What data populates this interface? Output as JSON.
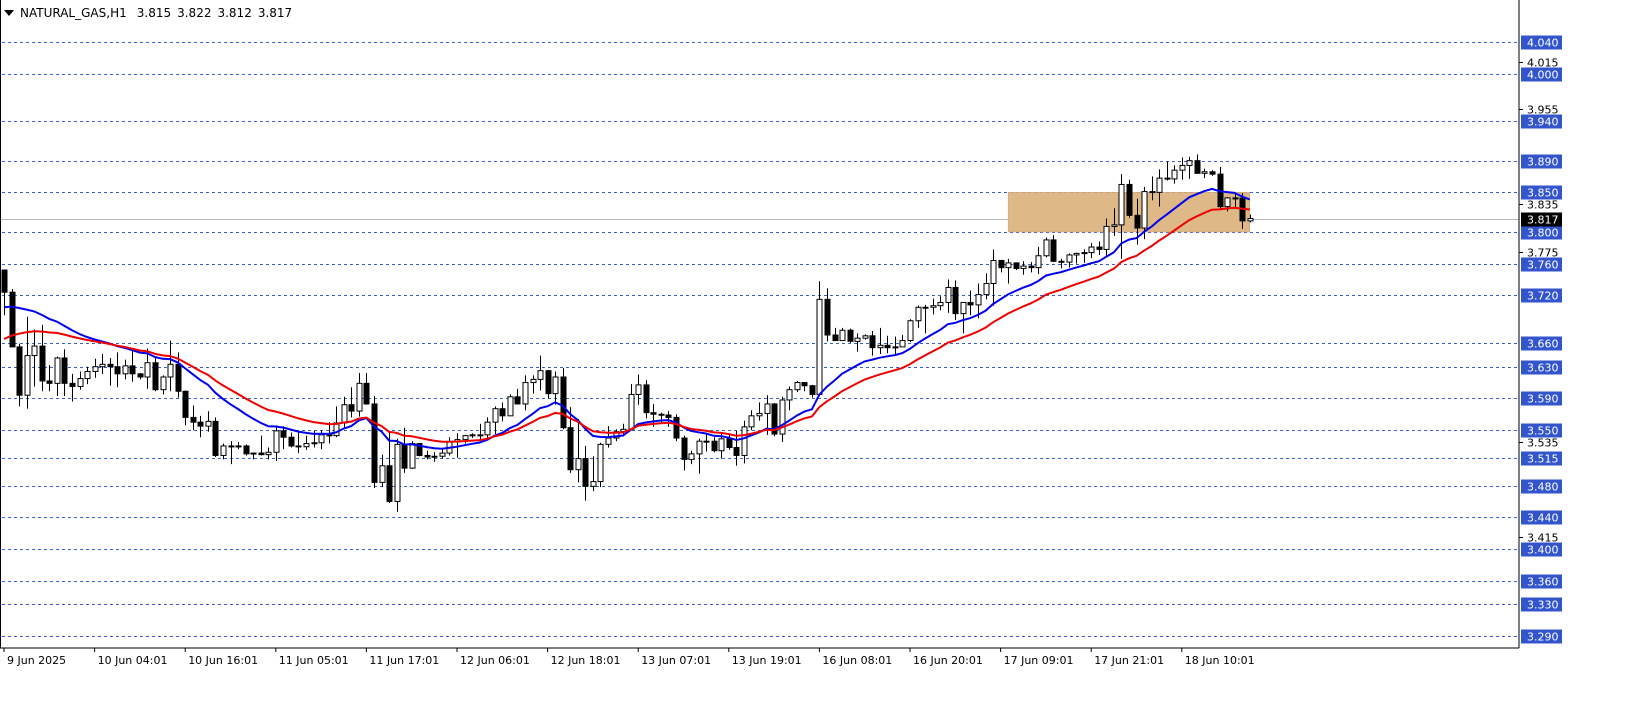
{
  "header": {
    "symbol": "NATURAL_GAS",
    "timeframe": "H1",
    "open": "3.815",
    "high": "3.822",
    "low": "3.812",
    "close": "3.817"
  },
  "chart_data": {
    "type": "candlestick",
    "ylim": [
      3.275,
      4.065
    ],
    "current_price": 3.817,
    "price_axis_ticks": [
      "4.015",
      "3.955",
      "3.835",
      "3.775",
      "3.535",
      "3.415"
    ],
    "price_levels": [
      4.04,
      4.0,
      3.94,
      3.89,
      3.85,
      3.8,
      3.76,
      3.72,
      3.66,
      3.63,
      3.59,
      3.55,
      3.515,
      3.48,
      3.44,
      3.4,
      3.36,
      3.33,
      3.29
    ],
    "price_level_labels": [
      "4.040",
      "4.000",
      "3.940",
      "3.890",
      "3.850",
      "3.800",
      "3.760",
      "3.720",
      "3.660",
      "3.630",
      "3.590",
      "3.550",
      "3.515",
      "3.480",
      "3.440",
      "3.400",
      "3.360",
      "3.330",
      "3.290"
    ],
    "time_labels": [
      "9 Jun 2025",
      "10 Jun 04:01",
      "10 Jun 16:01",
      "11 Jun 05:01",
      "11 Jun 17:01",
      "12 Jun 06:01",
      "12 Jun 18:01",
      "13 Jun 07:01",
      "13 Jun 19:01",
      "16 Jun 08:01",
      "16 Jun 20:01",
      "17 Jun 09:01",
      "17 Jun 21:01",
      "18 Jun 10:01"
    ],
    "time_label_bar_index": [
      0,
      12,
      24,
      36,
      48,
      60,
      72,
      84,
      96,
      108,
      120,
      132,
      144,
      156
    ],
    "zone": {
      "bar_start": 133,
      "bar_end": 165,
      "top": 3.85,
      "bottom": 3.8,
      "color": "#deb887"
    },
    "series": [
      {
        "line": "ma_fast",
        "color": "#0000ee"
      },
      {
        "line": "ma_slow",
        "color": "#ee0000"
      }
    ],
    "anchors_close": [
      [
        0,
        3.74
      ],
      [
        1,
        3.62
      ],
      [
        6,
        3.61
      ],
      [
        12,
        3.63
      ],
      [
        18,
        3.63
      ],
      [
        22,
        3.6
      ],
      [
        25,
        3.54
      ],
      [
        28,
        3.52
      ],
      [
        33,
        3.54
      ],
      [
        38,
        3.55
      ],
      [
        42,
        3.58
      ],
      [
        45,
        3.6
      ],
      [
        47,
        3.54
      ],
      [
        49,
        3.48
      ],
      [
        51,
        3.51
      ],
      [
        55,
        3.52
      ],
      [
        58,
        3.55
      ],
      [
        61,
        3.57
      ],
      [
        64,
        3.6
      ],
      [
        67,
        3.61
      ],
      [
        70,
        3.58
      ],
      [
        72,
        3.49
      ],
      [
        73,
        3.49
      ],
      [
        75,
        3.54
      ],
      [
        77,
        3.57
      ],
      [
        79,
        3.61
      ],
      [
        82,
        3.56
      ],
      [
        85,
        3.53
      ],
      [
        88,
        3.52
      ],
      [
        90,
        3.53
      ],
      [
        93,
        3.52
      ],
      [
        95,
        3.57
      ],
      [
        97,
        3.6
      ],
      [
        99,
        3.6
      ],
      [
        100,
        3.66
      ],
      [
        103,
        3.66
      ],
      [
        106,
        3.66
      ],
      [
        108,
        3.67
      ],
      [
        112,
        3.7
      ],
      [
        114,
        3.7
      ],
      [
        117,
        3.67
      ],
      [
        118,
        3.74
      ],
      [
        120,
        3.75
      ],
      [
        124,
        3.74
      ],
      [
        127,
        3.77
      ],
      [
        132,
        3.79
      ],
      [
        135,
        3.84
      ],
      [
        137,
        3.81
      ],
      [
        139,
        3.82
      ],
      [
        140,
        3.79
      ],
      [
        141,
        3.85
      ],
      [
        145,
        3.87
      ],
      [
        148,
        3.89
      ],
      [
        150,
        3.88
      ],
      [
        153,
        3.88
      ],
      [
        154,
        3.83
      ],
      [
        156,
        3.84
      ],
      [
        157,
        3.84
      ],
      [
        158,
        3.82
      ],
      [
        159,
        3.817
      ]
    ],
    "candles": [
      [
        3.752,
        3.752,
        3.695,
        3.724
      ],
      [
        3.724,
        3.728,
        3.655,
        3.655
      ],
      [
        3.655,
        3.659,
        3.58,
        3.594
      ],
      [
        3.594,
        3.693,
        3.577,
        3.644
      ],
      [
        3.644,
        3.677,
        3.605,
        3.656
      ],
      [
        3.656,
        3.683,
        3.599,
        3.612
      ],
      [
        3.612,
        3.632,
        3.599,
        3.609
      ],
      [
        3.609,
        3.643,
        3.593,
        3.641
      ],
      [
        3.641,
        3.652,
        3.593,
        3.609
      ],
      [
        3.609,
        3.621,
        3.586,
        3.605
      ],
      [
        3.605,
        3.624,
        3.601,
        3.615
      ],
      [
        3.615,
        3.63,
        3.608,
        3.624
      ],
      [
        3.624,
        3.64,
        3.616,
        3.63
      ],
      [
        3.63,
        3.646,
        3.621,
        3.633
      ],
      [
        3.633,
        3.641,
        3.606,
        3.63
      ],
      [
        3.63,
        3.648,
        3.604,
        3.621
      ],
      [
        3.621,
        3.639,
        3.614,
        3.631
      ],
      [
        3.631,
        3.651,
        3.611,
        3.621
      ],
      [
        3.621,
        3.622,
        3.614,
        3.617
      ],
      [
        3.617,
        3.653,
        3.602,
        3.635
      ],
      [
        3.635,
        3.641,
        3.599,
        3.601
      ],
      [
        3.601,
        3.619,
        3.595,
        3.617
      ],
      [
        3.617,
        3.663,
        3.599,
        3.633
      ],
      [
        3.633,
        3.648,
        3.591,
        3.599
      ],
      [
        3.599,
        3.6,
        3.556,
        3.566
      ],
      [
        3.566,
        3.581,
        3.55,
        3.56
      ],
      [
        3.56,
        3.568,
        3.541,
        3.555
      ],
      [
        3.555,
        3.574,
        3.548,
        3.561
      ],
      [
        3.561,
        3.566,
        3.516,
        3.518
      ],
      [
        3.518,
        3.533,
        3.513,
        3.53
      ],
      [
        3.53,
        3.536,
        3.507,
        3.53
      ],
      [
        3.53,
        3.535,
        3.526,
        3.53
      ],
      [
        3.53,
        3.532,
        3.518,
        3.52
      ],
      [
        3.52,
        3.521,
        3.513,
        3.521
      ],
      [
        3.521,
        3.543,
        3.518,
        3.519
      ],
      [
        3.519,
        3.528,
        3.513,
        3.522
      ],
      [
        3.522,
        3.556,
        3.511,
        3.549
      ],
      [
        3.549,
        3.555,
        3.526,
        3.541
      ],
      [
        3.541,
        3.547,
        3.528,
        3.53
      ],
      [
        3.53,
        3.548,
        3.521,
        3.529
      ],
      [
        3.529,
        3.543,
        3.525,
        3.533
      ],
      [
        3.533,
        3.549,
        3.528,
        3.534
      ],
      [
        3.534,
        3.55,
        3.526,
        3.544
      ],
      [
        3.544,
        3.56,
        3.533,
        3.543
      ],
      [
        3.543,
        3.58,
        3.541,
        3.559
      ],
      [
        3.559,
        3.592,
        3.552,
        3.582
      ],
      [
        3.582,
        3.604,
        3.566,
        3.574
      ],
      [
        3.574,
        3.622,
        3.567,
        3.609
      ],
      [
        3.609,
        3.622,
        3.582,
        3.583
      ],
      [
        3.583,
        3.593,
        3.477,
        3.484
      ],
      [
        3.484,
        3.519,
        3.478,
        3.505
      ],
      [
        3.505,
        3.549,
        3.458,
        3.46
      ],
      [
        3.46,
        3.539,
        3.447,
        3.532
      ],
      [
        3.532,
        3.553,
        3.496,
        3.502
      ],
      [
        3.502,
        3.536,
        3.501,
        3.533
      ],
      [
        3.533,
        3.533,
        3.517,
        3.518
      ],
      [
        3.518,
        3.524,
        3.513,
        3.516
      ],
      [
        3.516,
        3.522,
        3.51,
        3.517
      ],
      [
        3.517,
        3.527,
        3.514,
        3.521
      ],
      [
        3.521,
        3.541,
        3.518,
        3.535
      ],
      [
        3.535,
        3.546,
        3.515,
        3.538
      ],
      [
        3.538,
        3.544,
        3.533,
        3.543
      ],
      [
        3.543,
        3.546,
        3.54,
        3.544
      ],
      [
        3.544,
        3.558,
        3.537,
        3.544
      ],
      [
        3.544,
        3.566,
        3.539,
        3.56
      ],
      [
        3.56,
        3.58,
        3.545,
        3.577
      ],
      [
        3.577,
        3.585,
        3.561,
        3.568
      ],
      [
        3.568,
        3.595,
        3.568,
        3.592
      ],
      [
        3.592,
        3.602,
        3.583,
        3.583
      ],
      [
        3.583,
        3.619,
        3.575,
        3.61
      ],
      [
        3.61,
        3.619,
        3.596,
        3.614
      ],
      [
        3.614,
        3.644,
        3.6,
        3.625
      ],
      [
        3.625,
        3.626,
        3.59,
        3.596
      ],
      [
        3.596,
        3.624,
        3.582,
        3.617
      ],
      [
        3.617,
        3.628,
        3.551,
        3.553
      ],
      [
        3.553,
        3.579,
        3.496,
        3.5
      ],
      [
        3.5,
        3.564,
        3.484,
        3.514
      ],
      [
        3.514,
        3.53,
        3.461,
        3.479
      ],
      [
        3.479,
        3.517,
        3.473,
        3.485
      ],
      [
        3.485,
        3.534,
        3.478,
        3.532
      ],
      [
        3.532,
        3.555,
        3.528,
        3.54
      ],
      [
        3.54,
        3.551,
        3.536,
        3.548
      ],
      [
        3.548,
        3.558,
        3.542,
        3.551
      ],
      [
        3.551,
        3.608,
        3.55,
        3.595
      ],
      [
        3.595,
        3.62,
        3.582,
        3.607
      ],
      [
        3.607,
        3.613,
        3.565,
        3.572
      ],
      [
        3.572,
        3.583,
        3.554,
        3.57
      ],
      [
        3.57,
        3.572,
        3.558,
        3.569
      ],
      [
        3.569,
        3.574,
        3.554,
        3.566
      ],
      [
        3.566,
        3.57,
        3.536,
        3.54
      ],
      [
        3.54,
        3.543,
        3.499,
        3.513
      ],
      [
        3.513,
        3.524,
        3.507,
        3.52
      ],
      [
        3.52,
        3.539,
        3.495,
        3.536
      ],
      [
        3.536,
        3.545,
        3.523,
        3.536
      ],
      [
        3.536,
        3.541,
        3.522,
        3.524
      ],
      [
        3.524,
        3.545,
        3.514,
        3.539
      ],
      [
        3.539,
        3.546,
        3.525,
        3.528
      ],
      [
        3.528,
        3.549,
        3.505,
        3.518
      ],
      [
        3.518,
        3.562,
        3.508,
        3.554
      ],
      [
        3.554,
        3.575,
        3.55,
        3.568
      ],
      [
        3.568,
        3.585,
        3.562,
        3.571
      ],
      [
        3.571,
        3.594,
        3.544,
        3.583
      ],
      [
        3.583,
        3.584,
        3.542,
        3.545
      ],
      [
        3.545,
        3.592,
        3.535,
        3.588
      ],
      [
        3.588,
        3.605,
        3.575,
        3.601
      ],
      [
        3.601,
        3.612,
        3.598,
        3.61
      ],
      [
        3.61,
        3.61,
        3.599,
        3.606
      ],
      [
        3.606,
        3.607,
        3.591,
        3.595
      ],
      [
        3.595,
        3.738,
        3.593,
        3.715
      ],
      [
        3.715,
        3.729,
        3.662,
        3.67
      ],
      [
        3.67,
        3.679,
        3.663,
        3.663
      ],
      [
        3.663,
        3.679,
        3.663,
        3.676
      ],
      [
        3.676,
        3.678,
        3.66,
        3.662
      ],
      [
        3.662,
        3.672,
        3.649,
        3.666
      ],
      [
        3.666,
        3.671,
        3.664,
        3.669
      ],
      [
        3.669,
        3.675,
        3.644,
        3.654
      ],
      [
        3.654,
        3.679,
        3.646,
        3.657
      ],
      [
        3.657,
        3.669,
        3.647,
        3.654
      ],
      [
        3.654,
        3.668,
        3.645,
        3.655
      ],
      [
        3.655,
        3.67,
        3.66,
        3.663
      ],
      [
        3.663,
        3.69,
        3.661,
        3.688
      ],
      [
        3.688,
        3.707,
        3.679,
        3.705
      ],
      [
        3.705,
        3.708,
        3.672,
        3.705
      ],
      [
        3.705,
        3.716,
        3.696,
        3.707
      ],
      [
        3.707,
        3.719,
        3.701,
        3.711
      ],
      [
        3.711,
        3.74,
        3.698,
        3.73
      ],
      [
        3.73,
        3.739,
        3.689,
        3.697
      ],
      [
        3.697,
        3.711,
        3.672,
        3.711
      ],
      [
        3.711,
        3.726,
        3.695,
        3.708
      ],
      [
        3.708,
        3.735,
        3.691,
        3.721
      ],
      [
        3.721,
        3.748,
        3.715,
        3.735
      ],
      [
        3.735,
        3.778,
        3.707,
        3.764
      ],
      [
        3.764,
        3.765,
        3.749,
        3.755
      ],
      [
        3.755,
        3.766,
        3.735,
        3.761
      ],
      [
        3.761,
        3.756,
        3.752,
        3.754
      ],
      [
        3.754,
        3.763,
        3.746,
        3.757
      ],
      [
        3.757,
        3.762,
        3.749,
        3.755
      ],
      [
        3.755,
        3.781,
        3.747,
        3.77
      ],
      [
        3.77,
        3.793,
        3.768,
        3.79
      ],
      [
        3.79,
        3.796,
        3.762,
        3.763
      ],
      [
        3.763,
        3.766,
        3.754,
        3.762
      ],
      [
        3.762,
        3.773,
        3.755,
        3.771
      ],
      [
        3.771,
        3.774,
        3.76,
        3.773
      ],
      [
        3.773,
        3.778,
        3.761,
        3.774
      ],
      [
        3.774,
        3.786,
        3.767,
        3.781
      ],
      [
        3.781,
        3.788,
        3.771,
        3.778
      ],
      [
        3.778,
        3.817,
        3.77,
        3.807
      ],
      [
        3.807,
        3.83,
        3.795,
        3.809
      ],
      [
        3.809,
        3.873,
        3.766,
        3.86
      ],
      [
        3.86,
        3.866,
        3.818,
        3.821
      ],
      [
        3.821,
        3.842,
        3.784,
        3.805
      ],
      [
        3.805,
        3.857,
        3.791,
        3.851
      ],
      [
        3.851,
        3.87,
        3.84,
        3.85
      ],
      [
        3.85,
        3.879,
        3.832,
        3.868
      ],
      [
        3.868,
        3.889,
        3.865,
        3.867
      ],
      [
        3.867,
        3.884,
        3.861,
        3.878
      ],
      [
        3.878,
        3.894,
        3.866,
        3.884
      ],
      [
        3.884,
        3.895,
        3.867,
        3.89
      ],
      [
        3.89,
        3.898,
        3.874,
        3.874
      ],
      [
        3.874,
        3.88,
        3.868,
        3.876
      ],
      [
        3.876,
        3.878,
        3.871,
        3.873
      ],
      [
        3.873,
        3.882,
        3.828,
        3.832
      ],
      [
        3.832,
        3.844,
        3.826,
        3.843
      ],
      [
        3.843,
        3.848,
        3.83,
        3.843
      ],
      [
        3.843,
        3.849,
        3.804,
        3.814
      ],
      [
        3.814,
        3.822,
        3.812,
        3.817
      ]
    ]
  }
}
